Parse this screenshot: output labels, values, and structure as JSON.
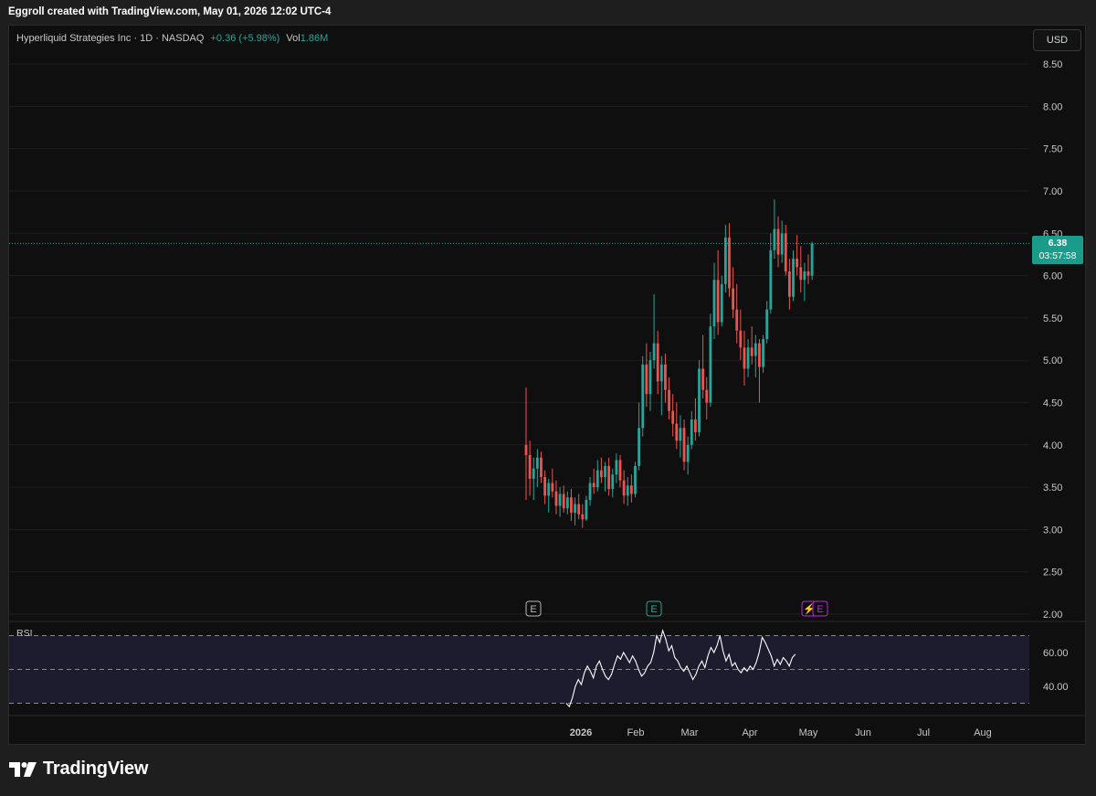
{
  "header": {
    "caption": "Eggroll created with TradingView.com, May 01, 2026 12:02 UTC-4"
  },
  "legend": {
    "symbol": "Hyperliquid Strategies Inc · 1D · NASDAQ",
    "change": "+0.36 (+5.98%)",
    "volume_label": "Vol",
    "volume_value": "1.86M"
  },
  "currency_button": "USD",
  "price_tag": {
    "price": "6.38",
    "countdown": "03:57:58"
  },
  "rsi_label": "RSI",
  "brand": "TradingView",
  "colors": {
    "up": "#26a69a",
    "down": "#ef5350",
    "rsi_line": "#ffffff",
    "rsi_band": "#1d1b2e",
    "grid": "#1f1f1f",
    "earnings_purple": "#b12bd6"
  },
  "chart_data": [
    {
      "type": "candlestick",
      "title": "Hyperliquid Strategies Inc · 1D · NASDAQ",
      "y_axis_ticks": [
        2.0,
        2.5,
        3.0,
        3.5,
        4.0,
        4.5,
        5.0,
        5.5,
        6.0,
        6.5,
        7.0,
        7.5,
        8.0,
        8.5
      ],
      "y_tick_labels": [
        "2.00",
        "2.50",
        "3.00",
        "3.50",
        "4.00",
        "4.50",
        "5.00",
        "5.50",
        "6.00",
        "6.50",
        "7.00",
        "7.50",
        "8.00",
        "8.50"
      ],
      "x_tick_labels": [
        "2026",
        "Feb",
        "Mar",
        "Apr",
        "May",
        "Jun",
        "Jul",
        "Aug"
      ],
      "last_price": 6.38,
      "candles": [
        [
          4.0,
          4.68,
          3.35,
          3.88
        ],
        [
          3.88,
          4.05,
          3.4,
          3.6
        ],
        [
          3.6,
          3.85,
          3.35,
          3.72
        ],
        [
          3.72,
          3.95,
          3.5,
          3.85
        ],
        [
          3.85,
          3.92,
          3.55,
          3.62
        ],
        [
          3.62,
          3.7,
          3.3,
          3.4
        ],
        [
          3.4,
          3.6,
          3.2,
          3.55
        ],
        [
          3.55,
          3.72,
          3.38,
          3.45
        ],
        [
          3.45,
          3.58,
          3.18,
          3.28
        ],
        [
          3.28,
          3.5,
          3.15,
          3.42
        ],
        [
          3.42,
          3.52,
          3.2,
          3.25
        ],
        [
          3.25,
          3.45,
          3.18,
          3.38
        ],
        [
          3.38,
          3.48,
          3.1,
          3.2
        ],
        [
          3.2,
          3.38,
          3.05,
          3.3
        ],
        [
          3.3,
          3.42,
          3.12,
          3.18
        ],
        [
          3.18,
          3.3,
          3.02,
          3.12
        ],
        [
          3.12,
          3.4,
          3.1,
          3.35
        ],
        [
          3.35,
          3.62,
          3.28,
          3.55
        ],
        [
          3.55,
          3.72,
          3.42,
          3.5
        ],
        [
          3.5,
          3.82,
          3.45,
          3.7
        ],
        [
          3.7,
          3.85,
          3.55,
          3.62
        ],
        [
          3.62,
          3.8,
          3.45,
          3.75
        ],
        [
          3.75,
          3.85,
          3.4,
          3.48
        ],
        [
          3.48,
          3.72,
          3.38,
          3.65
        ],
        [
          3.65,
          3.9,
          3.55,
          3.82
        ],
        [
          3.82,
          3.88,
          3.5,
          3.58
        ],
        [
          3.58,
          3.7,
          3.3,
          3.4
        ],
        [
          3.4,
          3.62,
          3.28,
          3.52
        ],
        [
          3.52,
          3.65,
          3.32,
          3.42
        ],
        [
          3.42,
          3.8,
          3.38,
          3.75
        ],
        [
          3.75,
          4.5,
          3.7,
          4.2
        ],
        [
          4.2,
          5.05,
          4.1,
          4.95
        ],
        [
          4.95,
          5.2,
          4.45,
          4.6
        ],
        [
          4.6,
          5.1,
          4.4,
          5.0
        ],
        [
          5.0,
          5.78,
          4.9,
          5.2
        ],
        [
          5.2,
          5.35,
          4.6,
          4.75
        ],
        [
          4.75,
          5.05,
          4.35,
          4.95
        ],
        [
          4.95,
          5.08,
          4.5,
          4.65
        ],
        [
          4.65,
          4.8,
          4.3,
          4.4
        ],
        [
          4.4,
          4.6,
          4.1,
          4.25
        ],
        [
          4.25,
          4.5,
          3.95,
          4.05
        ],
        [
          4.05,
          4.35,
          3.85,
          4.2
        ],
        [
          4.2,
          4.3,
          3.7,
          3.8
        ],
        [
          3.8,
          4.1,
          3.65,
          4.0
        ],
        [
          4.0,
          4.4,
          3.95,
          4.3
        ],
        [
          4.3,
          4.55,
          4.05,
          4.15
        ],
        [
          4.15,
          5.0,
          4.1,
          4.9
        ],
        [
          4.9,
          5.3,
          4.55,
          4.65
        ],
        [
          4.65,
          4.8,
          4.3,
          4.5
        ],
        [
          4.5,
          5.55,
          4.45,
          5.4
        ],
        [
          5.4,
          6.15,
          5.25,
          5.95
        ],
        [
          5.95,
          6.3,
          5.3,
          5.45
        ],
        [
          5.45,
          6.0,
          5.4,
          5.9
        ],
        [
          5.9,
          6.6,
          5.8,
          6.45
        ],
        [
          6.45,
          6.62,
          5.75,
          5.85
        ],
        [
          5.85,
          6.1,
          5.5,
          5.6
        ],
        [
          5.6,
          5.9,
          5.2,
          5.35
        ],
        [
          5.35,
          5.6,
          5.0,
          5.15
        ],
        [
          5.15,
          5.35,
          4.7,
          4.9
        ],
        [
          4.9,
          5.25,
          4.8,
          5.15
        ],
        [
          5.15,
          5.4,
          4.95,
          5.05
        ],
        [
          5.05,
          5.3,
          4.8,
          5.2
        ],
        [
          5.2,
          5.25,
          4.5,
          4.92
        ],
        [
          4.92,
          5.3,
          4.85,
          5.25
        ],
        [
          5.25,
          5.7,
          5.2,
          5.6
        ],
        [
          5.6,
          6.5,
          5.55,
          6.3
        ],
        [
          6.3,
          6.9,
          6.2,
          6.55
        ],
        [
          6.55,
          6.7,
          6.1,
          6.25
        ],
        [
          6.25,
          6.65,
          6.15,
          6.5
        ],
        [
          6.5,
          6.6,
          6.0,
          6.05
        ],
        [
          6.05,
          6.2,
          5.6,
          5.75
        ],
        [
          5.75,
          6.3,
          5.7,
          6.2
        ],
        [
          6.2,
          6.48,
          6.0,
          6.1
        ],
        [
          6.1,
          6.35,
          5.8,
          5.95
        ],
        [
          5.95,
          6.15,
          5.7,
          6.05
        ],
        [
          6.05,
          6.25,
          5.9,
          6.0
        ],
        [
          6.0,
          6.4,
          5.95,
          6.38
        ]
      ],
      "events": [
        "E",
        "E",
        "⚡",
        "E"
      ]
    },
    {
      "type": "line",
      "title": "RSI",
      "y_tick_labels": [
        "60.00",
        "40.00"
      ],
      "levels": [
        30,
        50,
        70
      ],
      "values": [
        30,
        28,
        33,
        40,
        44,
        41,
        48,
        52,
        49,
        45,
        52,
        55,
        50,
        46,
        44,
        47,
        53,
        58,
        56,
        60,
        57,
        54,
        58,
        55,
        50,
        46,
        48,
        52,
        54,
        60,
        70,
        66,
        73,
        68,
        61,
        64,
        57,
        55,
        51,
        49,
        52,
        48,
        44,
        47,
        52,
        55,
        51,
        58,
        63,
        60,
        64,
        70,
        61,
        55,
        59,
        52,
        54,
        50,
        48,
        51,
        49,
        52,
        50,
        54,
        60,
        69,
        66,
        62,
        58,
        52,
        56,
        53,
        57,
        55,
        52,
        57,
        59
      ]
    }
  ]
}
